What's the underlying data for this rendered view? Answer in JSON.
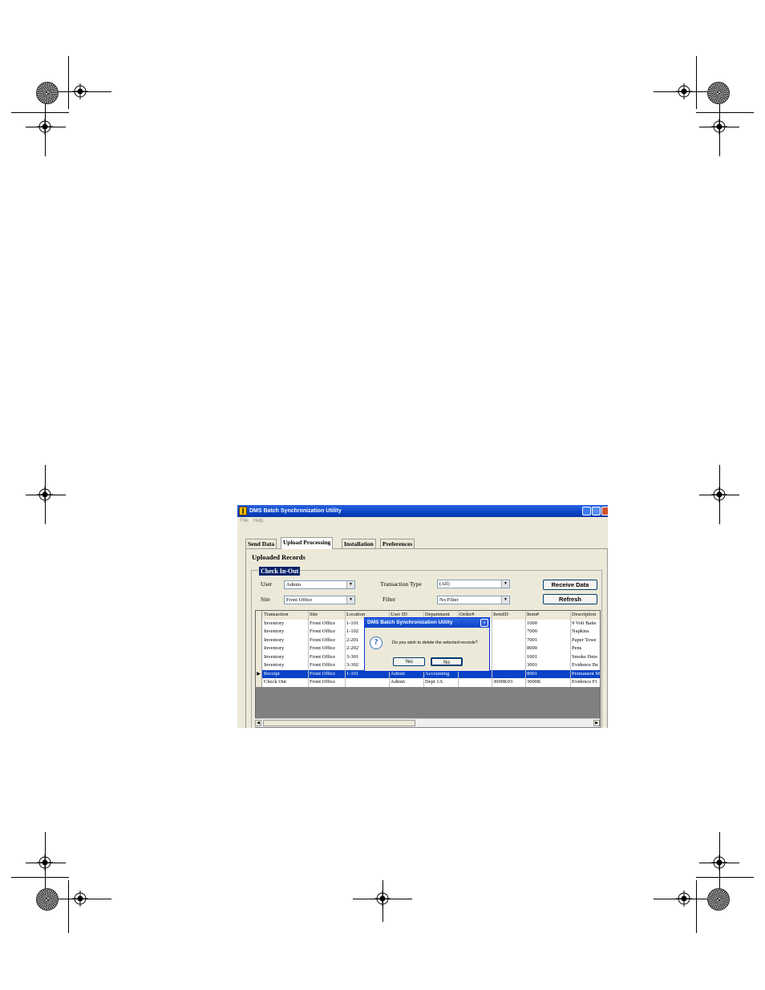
{
  "window": {
    "title": "DMS Batch Synchronization Utility",
    "menu": [
      "File",
      "Help"
    ]
  },
  "tabs": [
    "Send Data",
    "Upload Processing",
    "Installation",
    "Preferences"
  ],
  "active_tab": "Upload Processing",
  "section_title": "Uploaded Records",
  "group_title": "Check In-Out",
  "filters": {
    "user_label": "User",
    "user_value": "Admin",
    "site_label": "Site",
    "site_value": "Front Office",
    "transaction_type_label": "Transaction Type",
    "transaction_type_value": "(All)",
    "filter_label": "Filter",
    "filter_value": "No Filter"
  },
  "buttons": {
    "receive_data": "Receive Data",
    "refresh": "Refresh"
  },
  "grid": {
    "columns": [
      "Transaction",
      "Site",
      "Location",
      "User ID",
      "Department",
      "Order#",
      "ItemID",
      "Item#",
      "Description"
    ],
    "rows": [
      [
        "Inventory",
        "Front Office",
        "1-101",
        "",
        "",
        "",
        "",
        "1000",
        "9 Volt Batte"
      ],
      [
        "Inventory",
        "Front Office",
        "1-102",
        "",
        "",
        "",
        "",
        "7000",
        "Napkins"
      ],
      [
        "Inventory",
        "Front Office",
        "2-201",
        "",
        "",
        "",
        "",
        "7001",
        "Paper Towe"
      ],
      [
        "Inventory",
        "Front Office",
        "2-202",
        "",
        "",
        "",
        "",
        "8000",
        "Pens"
      ],
      [
        "Inventory",
        "Front Office",
        "3-301",
        "",
        "",
        "",
        "",
        "1001",
        "Smoke Dete"
      ],
      [
        "Inventory",
        "Front Office",
        "3-302",
        "",
        "",
        "",
        "",
        "3001",
        "Evidence Be"
      ],
      [
        "Receipt",
        "Front Office",
        "1-101",
        "Admin",
        "Accounting",
        "",
        "",
        "8001",
        "Permanent M"
      ],
      [
        "Check Out",
        "Front Office",
        "",
        "Admin",
        "Dept 1A",
        "",
        "3000K03",
        "3000K",
        "Evidence Fi"
      ]
    ],
    "selected_row": 6,
    "current_row_marker": "▶"
  },
  "dialog": {
    "title": "DMS Batch Synchronization Utility",
    "icon": "question-icon",
    "message": "Do you wish to delete the selected records?",
    "yes": "Yes",
    "no": "No"
  }
}
